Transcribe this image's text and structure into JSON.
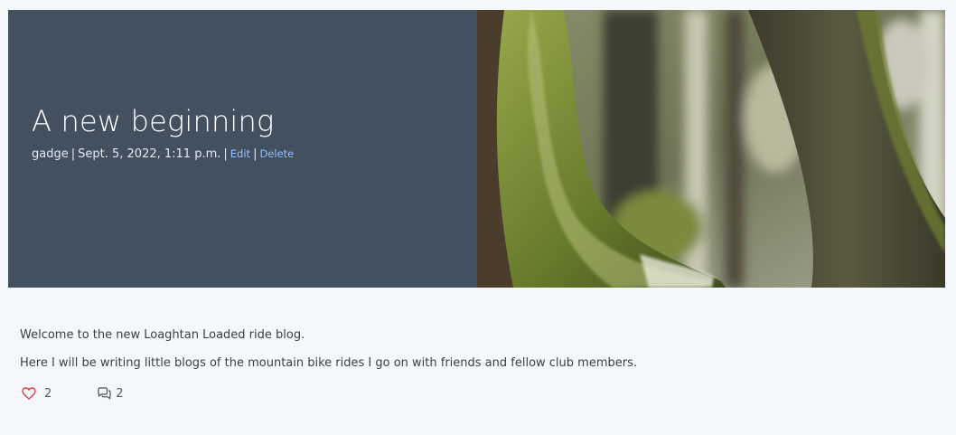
{
  "post": {
    "title": "A new beginning",
    "author": "gadge",
    "meta_separator": "|",
    "date": "Sept. 5, 2022, 1:11 p.m.",
    "edit_label": "Edit",
    "delete_label": "Delete",
    "image_icon": "mossy-tree-photo",
    "paragraphs": [
      "Welcome to the new Loaghtan Loaded ride blog.",
      "Here I will be writing little blogs of the mountain bike rides I go on with friends and fellow club members."
    ],
    "likes": {
      "icon": "heart-icon",
      "count": "2",
      "color": "#dc3545"
    },
    "comments": {
      "icon": "comments-icon",
      "count": "2"
    }
  },
  "theme": {
    "hero_panel": "#435060",
    "page_background": "#f4f8fc",
    "link": "#8fc3ff"
  }
}
